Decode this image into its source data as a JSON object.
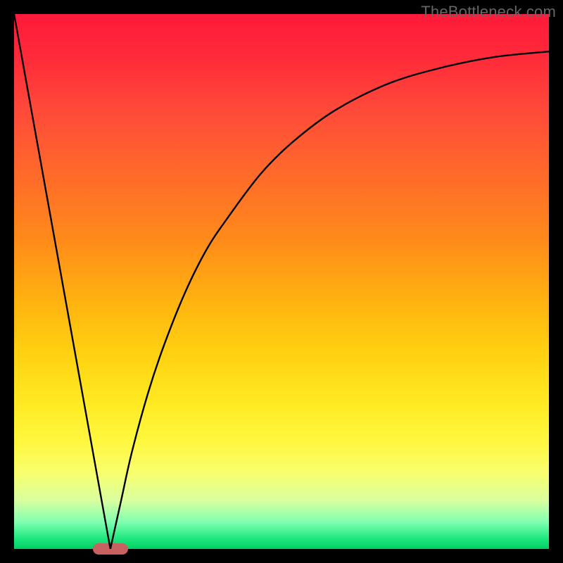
{
  "watermark": "TheBottleneck.com",
  "colors": {
    "frame": "#000000",
    "line": "#000000",
    "marker": "#c86262",
    "gradient_stops": [
      "#ff1a3a",
      "#ff4a3a",
      "#ff8a1a",
      "#ffd010",
      "#fff840",
      "#d8ffa0",
      "#20e880"
    ]
  },
  "chart_data": {
    "type": "line",
    "title": "",
    "xlabel": "",
    "ylabel": "",
    "xlim": [
      0,
      100
    ],
    "ylim": [
      0,
      100
    ],
    "note": "No axis ticks or labels visible. Values are estimated from pixel positions on a 0–100 normalized scale (x left→right, y bottom→top).",
    "series": [
      {
        "name": "left-line",
        "x": [
          0,
          18
        ],
        "y": [
          100,
          0
        ]
      },
      {
        "name": "right-curve",
        "x": [
          18,
          20,
          22,
          25,
          28,
          32,
          36,
          40,
          46,
          52,
          60,
          70,
          80,
          90,
          100
        ],
        "y": [
          0,
          9,
          18,
          29,
          38,
          48,
          56,
          62,
          70,
          76,
          82,
          87,
          90,
          92,
          93
        ]
      }
    ],
    "marker": {
      "name": "valley-marker",
      "x": 18,
      "y": 0,
      "width_frac": 0.066,
      "color": "#c86262"
    }
  }
}
